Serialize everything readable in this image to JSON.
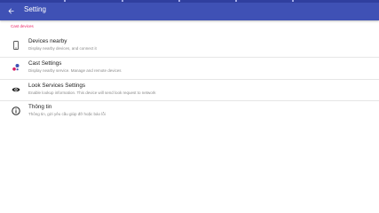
{
  "app_bar": {
    "title": "Setting",
    "back_icon": "arrow-back-icon"
  },
  "section": {
    "header": "Cast devices"
  },
  "items": [
    {
      "title": "Devices nearby",
      "summary": "Display nearby devices, and connect it",
      "icon": "phone-icon"
    },
    {
      "title": "Cast Settings",
      "summary": "Display nearby service. Manage and remote devices",
      "icon": "cast-settings-icon"
    },
    {
      "title": "Look Services Settings",
      "summary": "Enable lookup information. This device will send look request to network",
      "icon": "eye-icon"
    },
    {
      "title": "Thông tin",
      "summary": "Thông tin, gởi yêu cầu giúp đỡ hoặc báo lỗi",
      "icon": "info-icon"
    }
  ],
  "colors": {
    "app_bar": "#3f51b5",
    "accent": "#e91e63"
  }
}
